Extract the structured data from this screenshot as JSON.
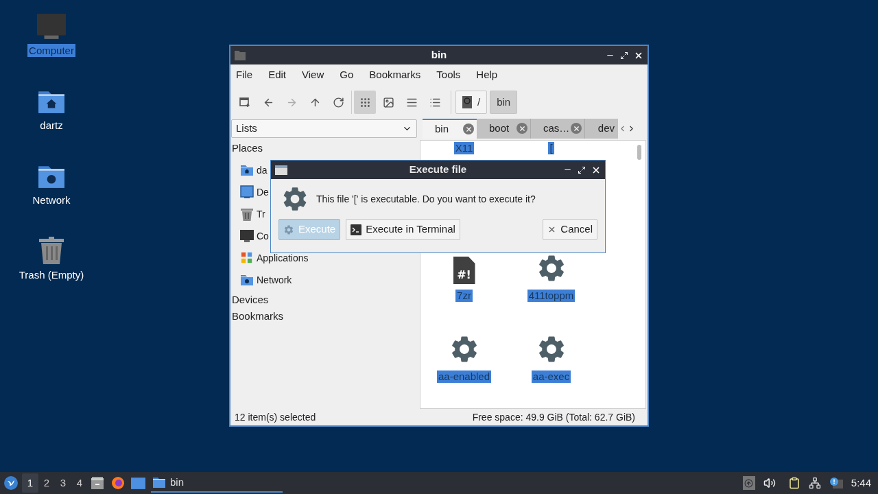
{
  "desktop_icons": [
    {
      "label": "Computer",
      "kind": "computer",
      "selected": true
    },
    {
      "label": "dartz",
      "kind": "home",
      "selected": false
    },
    {
      "label": "Network",
      "kind": "network",
      "selected": false
    },
    {
      "label": "Trash (Empty)",
      "kind": "trash",
      "selected": false
    }
  ],
  "file_manager": {
    "title": "bin",
    "menu": [
      "File",
      "Edit",
      "View",
      "Go",
      "Bookmarks",
      "Tools",
      "Help"
    ],
    "nav_buttons": [
      {
        "kind": "new-tab",
        "disabled": false
      },
      {
        "kind": "back",
        "disabled": false
      },
      {
        "kind": "forward",
        "disabled": true
      },
      {
        "kind": "up",
        "disabled": false
      },
      {
        "kind": "reload",
        "disabled": false
      }
    ],
    "view_buttons": [
      {
        "kind": "icons",
        "selected": true
      },
      {
        "kind": "thumbnails",
        "selected": false
      },
      {
        "kind": "compact",
        "selected": false
      },
      {
        "kind": "details",
        "selected": false
      }
    ],
    "path": [
      {
        "label": "/",
        "kind": "root",
        "selected": false
      },
      {
        "label": "bin",
        "kind": "folder",
        "selected": true
      }
    ],
    "side_pane_mode": "Lists",
    "tabs": [
      {
        "label": "bin",
        "selected": true
      },
      {
        "label": "boot",
        "selected": false
      },
      {
        "label": "cas…",
        "selected": false
      },
      {
        "label": "dev",
        "selected": false
      }
    ],
    "places_heading": "Places",
    "places": [
      {
        "label": "da",
        "kind": "home"
      },
      {
        "label": "De",
        "kind": "desktop"
      },
      {
        "label": "Tr",
        "kind": "trash"
      },
      {
        "label": "Co",
        "kind": "computer"
      },
      {
        "label": "Applications",
        "kind": "applications"
      },
      {
        "label": "Network",
        "kind": "network"
      }
    ],
    "sections": [
      "Devices",
      "Bookmarks"
    ],
    "file_rows": [
      [
        {
          "name": "X11",
          "kind": "hidden",
          "selected": true
        },
        {
          "name": "[",
          "kind": "hidden",
          "selected": true
        }
      ],
      [
        {
          "name": "7zr",
          "kind": "script",
          "glyph": "#!",
          "selected": true
        },
        {
          "name": "411toppm",
          "kind": "executable",
          "selected": true
        }
      ],
      [
        {
          "name": "aa-enabled",
          "kind": "executable",
          "selected": true
        },
        {
          "name": "aa-exec",
          "kind": "executable",
          "selected": true
        }
      ]
    ],
    "status_left": "12 item(s) selected",
    "status_right": "Free space: 49.9 GiB (Total: 62.7 GiB)"
  },
  "dialog": {
    "title": "Execute file",
    "message": "This file '[' is executable. Do you want to execute it?",
    "buttons": [
      {
        "label": "Execute",
        "kind": "execute",
        "focused": true
      },
      {
        "label": "Execute in Terminal",
        "kind": "terminal",
        "focused": false
      },
      {
        "label": "Cancel",
        "kind": "cancel",
        "focused": false
      }
    ]
  },
  "taskbar": {
    "workspaces": [
      {
        "label": "1",
        "selected": true
      },
      {
        "label": "2",
        "selected": false
      },
      {
        "label": "3",
        "selected": false
      },
      {
        "label": "4",
        "selected": false
      }
    ],
    "tasks": [
      {
        "label": "bin",
        "selected": true
      }
    ],
    "clock": "5:44"
  }
}
